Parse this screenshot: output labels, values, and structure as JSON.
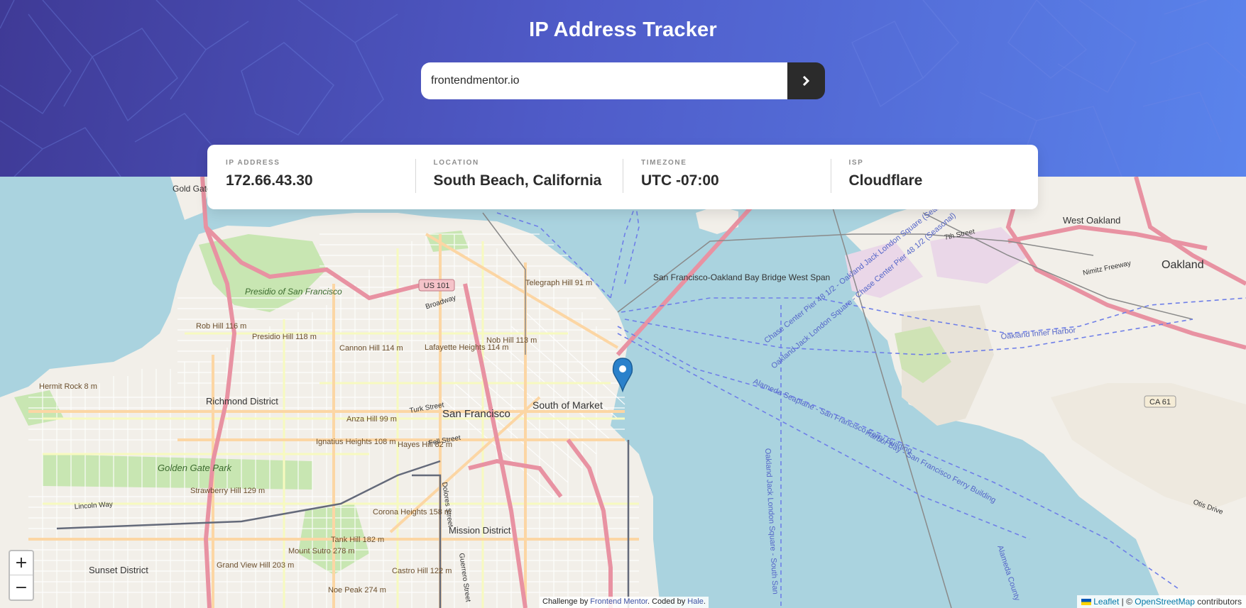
{
  "header": {
    "title": "IP Address Tracker",
    "search_value": "frontendmentor.io",
    "search_button_icon": "chevron-right-icon"
  },
  "info": {
    "ip_label": "IP ADDRESS",
    "ip_value": "172.66.43.30",
    "location_label": "LOCATION",
    "location_value": "South Beach, California",
    "timezone_label": "TIMEZONE",
    "timezone_value": "UTC -07:00",
    "isp_label": "ISP",
    "isp_value": "Cloudflare"
  },
  "map": {
    "zoom_in": "+",
    "zoom_out": "−",
    "marker_icon": "location-pin-icon",
    "places": {
      "san_francisco": "San Francisco",
      "south_of_market": "South of Market",
      "richmond_district": "Richmond District",
      "sunset_district": "Sunset District",
      "mission_district": "Mission District",
      "oakland": "Oakland",
      "west_oakland": "West Oakland",
      "golden_gate_park": "Golden Gate Park",
      "presidio": "Presidio of San Francisco",
      "bay_bridge": "San Francisco-Oakland Bay Bridge West Span",
      "telegraph_hill": "Telegraph Hill 91 m",
      "nob_hill": "Nob Hill 113 m",
      "lafayette_heights": "Lafayette Heights 114 m",
      "cannon_hill": "Cannon Hill 114 m",
      "rob_hill": "Rob Hill 116 m",
      "presidio_hill": "Presidio Hill 118 m",
      "hermit_rock": "Hermit Rock 8 m",
      "anza_hill": "Anza Hill 99 m",
      "ignatius_heights": "Ignatius Heights 108 m",
      "hayes_hill": "Hayes Hill 82 m",
      "strawberry_hill": "Strawberry Hill 129 m",
      "corona_heights": "Corona Heights 158 m",
      "tank_hill": "Tank Hill 182 m",
      "mount_sutro": "Mount Sutro 278 m",
      "grand_view_hill": "Grand View Hill 203 m",
      "noe_peak": "Noe Peak 274 m",
      "castro_hill": "Castro Hill 122 m",
      "gate_bridge": "Gold Gate Bri",
      "us101": "US 101",
      "ca61": "CA 61",
      "broadway": "Broadway",
      "turk_street": "Turk Street",
      "fell_street": "Fell Street",
      "lincoln_way": "Lincoln Way",
      "dolores_street": "Dolores Street",
      "guerrero_street": "Guerrero Street",
      "seventh_street": "7th Street",
      "nimitz_freeway": "Nimitz Freeway",
      "otis_drive": "Otis Drive",
      "ferry_chase": "Chase Center Pier 48 1/2 - Oakland Jack London Square (Seasonal)",
      "ferry_oakland": "Oakland Jack London Square - Chase Center Pier 48 1/2 (Seasonal)",
      "ferry_alameda": "Alameda Seaplane - San Francisco Ferry Building",
      "ferry_harbor": "Harbor Bay - San Francisco Ferry Building",
      "ferry_oakland_south": "Oakland Jack London Square - South San",
      "oakland_inner_harbor": "Oakland Inner Harbor",
      "alameda_county": "Alameda County"
    }
  },
  "challenge": {
    "prefix": "Challenge by ",
    "link1": "Frontend Mentor",
    "middle": ". Coded by ",
    "link2": "Hale",
    "suffix": "."
  },
  "attribution": {
    "leaflet": "Leaflet",
    "sep": " | © ",
    "osm": "OpenStreetMap",
    "suffix": " contributors"
  },
  "colors": {
    "header_start": "#3f3a96",
    "header_end": "#5a84ec",
    "water": "#aad3df",
    "land": "#f2efe9",
    "park": "#c8e6b2",
    "motorway": "#e892a2",
    "primary_road": "#fcd6a4",
    "ferry_route": "#6f7fe8",
    "marker": "#2a81cb"
  }
}
